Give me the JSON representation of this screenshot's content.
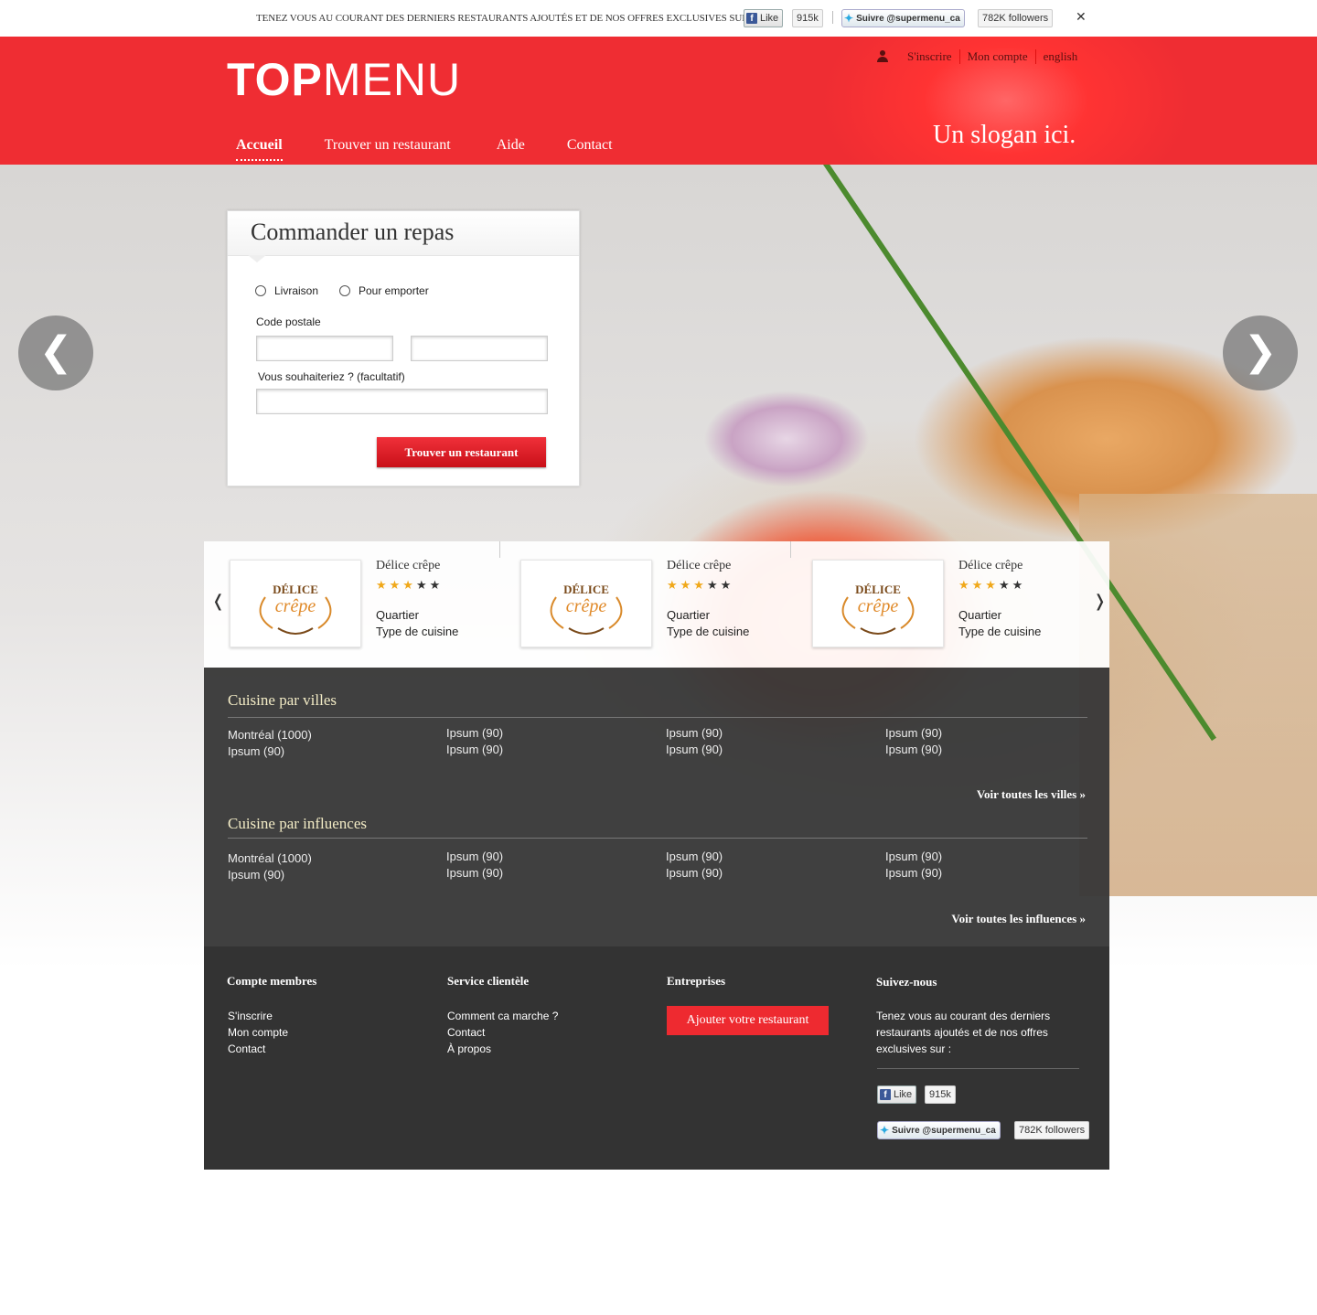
{
  "topbar": {
    "message": "TENEZ VOUS AU COURANT DES DERNIERS RESTAURANTS AJOUTÉS ET DE NOS OFFRES EXCLUSIVES SUR :",
    "fb_like": "Like",
    "fb_count": "915k",
    "tw_follow": "Suivre @supermenu_ca",
    "tw_count": "782K followers",
    "close": "✕"
  },
  "header": {
    "logo_bold": "TOP",
    "logo_light": "MENU",
    "links": [
      "S'inscrire",
      "Mon compte",
      "english"
    ],
    "nav": [
      "Accueil",
      "Trouver un restaurant",
      "Aide",
      "Contact"
    ],
    "slogan": "Un slogan ici."
  },
  "order": {
    "title": "Commander un repas",
    "option_delivery": "Livraison",
    "option_takeout": "Pour emporter",
    "postal_label": "Code postale",
    "wish_label": "Vous souhaiteriez ? (facultatif)",
    "button": "Trouver un restaurant"
  },
  "slider": {
    "prev": "❮",
    "next": "❯"
  },
  "carousel": {
    "prev": "❬",
    "next": "❭",
    "cards": [
      {
        "name": "Délice crêpe",
        "rating": 3,
        "max": 5,
        "quartier": "Quartier",
        "type": "Type de cuisine",
        "logo_top": "DÉLICE",
        "logo_bottom": "crêpe"
      },
      {
        "name": "Délice crêpe",
        "rating": 3,
        "max": 5,
        "quartier": "Quartier",
        "type": "Type de cuisine",
        "logo_top": "DÉLICE",
        "logo_bottom": "crêpe"
      },
      {
        "name": "Délice crêpe",
        "rating": 3,
        "max": 5,
        "quartier": "Quartier",
        "type": "Type de cuisine",
        "logo_top": "DÉLICE",
        "logo_bottom": "crêpe"
      }
    ]
  },
  "cities": {
    "title": "Cuisine par villes",
    "columns": [
      [
        "Montréal (1000)",
        "Ipsum (90)"
      ],
      [
        "Ipsum (90)",
        "Ipsum (90)"
      ],
      [
        "Ipsum (90)",
        "Ipsum (90)"
      ],
      [
        "Ipsum (90)",
        "Ipsum (90)"
      ]
    ],
    "more": "Voir toutes les villes »"
  },
  "influences": {
    "title": "Cuisine par influences",
    "columns": [
      [
        "Montréal (1000)",
        "Ipsum (90)"
      ],
      [
        "Ipsum (90)",
        "Ipsum (90)"
      ],
      [
        "Ipsum (90)",
        "Ipsum (90)"
      ],
      [
        "Ipsum (90)",
        "Ipsum (90)"
      ]
    ],
    "more": "Voir toutes les influences »"
  },
  "footer": {
    "members_title": "Compte membres",
    "members": [
      "S'inscrire",
      "Mon compte",
      "Contact"
    ],
    "service_title": "Service clientèle",
    "service": [
      "Comment ca marche ?",
      "Contact",
      "À propos"
    ],
    "business_title": "Entreprises",
    "add_button": "Ajouter votre restaurant",
    "follow_title": "Suivez-nous",
    "follow_text": "Tenez vous au courant des derniers restaurants ajoutés et de nos offres exclusives sur :"
  },
  "colors": {
    "brand_red": "#ef2d33",
    "star": "#f0a81a"
  }
}
